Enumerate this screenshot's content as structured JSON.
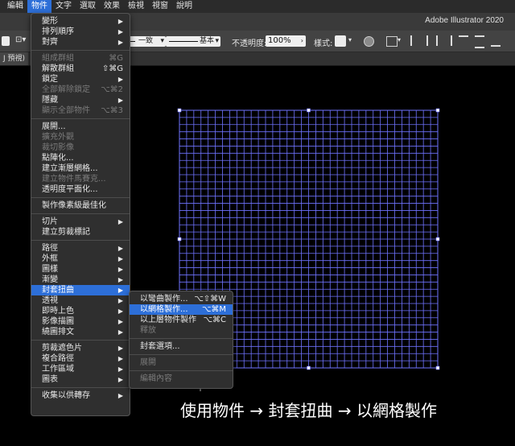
{
  "menubar": [
    "編輯",
    "物件",
    "文字",
    "選取",
    "效果",
    "檢視",
    "視窗",
    "說明"
  ],
  "app_title": "Adobe Illustrator 2020",
  "control": {
    "stroke_style": "一致",
    "brush": "基本",
    "opacity_label": "不透明度:",
    "opacity_value": "100%",
    "style_label": "樣式:"
  },
  "doc_tab": "J 預視)",
  "object_menu": [
    {
      "label": "變形",
      "arrow": true
    },
    {
      "label": "排列順序",
      "arrow": true
    },
    {
      "label": "對齊",
      "arrow": true
    },
    {
      "sep": true
    },
    {
      "label": "組成群組",
      "shortcut": "⌘G",
      "disabled": true
    },
    {
      "label": "解散群組",
      "shortcut": "⇧⌘G"
    },
    {
      "label": "鎖定",
      "arrow": true
    },
    {
      "label": "全部解除鎖定",
      "shortcut": "⌥⌘2",
      "disabled": true
    },
    {
      "label": "隱藏",
      "arrow": true
    },
    {
      "label": "顯示全部物件",
      "shortcut": "⌥⌘3",
      "disabled": true
    },
    {
      "sep": true
    },
    {
      "label": "展開..."
    },
    {
      "label": "擴充外觀",
      "disabled": true
    },
    {
      "label": "裁切影像",
      "disabled": true
    },
    {
      "label": "點陣化..."
    },
    {
      "label": "建立漸層網格..."
    },
    {
      "label": "建立物件馬賽克...",
      "disabled": true
    },
    {
      "label": "透明度平面化..."
    },
    {
      "sep": true
    },
    {
      "label": "製作像素級最佳化"
    },
    {
      "sep": true
    },
    {
      "label": "切片",
      "arrow": true
    },
    {
      "label": "建立剪裁標記"
    },
    {
      "sep": true
    },
    {
      "label": "路徑",
      "arrow": true
    },
    {
      "label": "外框",
      "arrow": true
    },
    {
      "label": "圖樣",
      "arrow": true
    },
    {
      "label": "漸變",
      "arrow": true
    },
    {
      "label": "封套扭曲",
      "arrow": true,
      "highlight": true
    },
    {
      "label": "透視",
      "arrow": true
    },
    {
      "label": "即時上色",
      "arrow": true
    },
    {
      "label": "影像描圖",
      "arrow": true
    },
    {
      "label": "繞圖排文",
      "arrow": true
    },
    {
      "sep": true
    },
    {
      "label": "剪裁遮色片",
      "arrow": true
    },
    {
      "label": "複合路徑",
      "arrow": true
    },
    {
      "label": "工作區域",
      "arrow": true
    },
    {
      "label": "圖表",
      "arrow": true
    },
    {
      "sep": true
    },
    {
      "label": "收集以供轉存",
      "arrow": true
    }
  ],
  "envelope_submenu": [
    {
      "label": "以彎曲製作...",
      "shortcut": "⌥⇧⌘W"
    },
    {
      "label": "以網格製作...",
      "shortcut": "⌥⌘M",
      "highlight": true
    },
    {
      "label": "以上層物件製作",
      "shortcut": "⌥⌘C"
    },
    {
      "label": "釋放",
      "disabled": true
    },
    {
      "sep": true
    },
    {
      "label": "封套選項..."
    },
    {
      "sep": true
    },
    {
      "label": "展開",
      "disabled": true
    },
    {
      "sep": true
    },
    {
      "label": "編輯內容",
      "disabled": true
    }
  ],
  "caption": "使用物件 → 封套扭曲 → 以網格製作",
  "colors": {
    "accent": "#2d6fd8",
    "grid": "#6f73ff",
    "menu_bg": "#2f2f2f"
  }
}
